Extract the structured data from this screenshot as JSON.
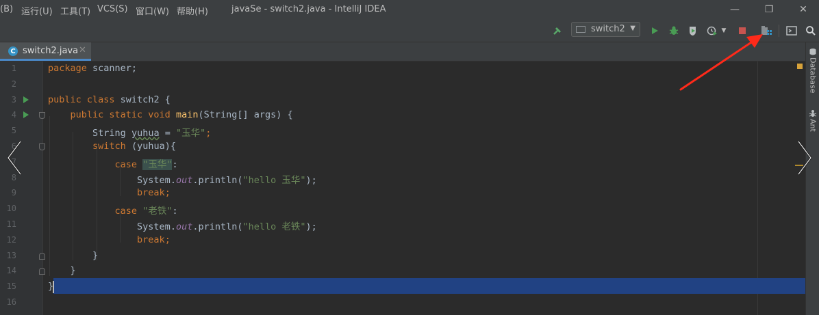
{
  "menubar": {
    "items": [
      "(B)",
      "运行(U)",
      "工具(T)",
      "VCS(S)",
      "窗口(W)",
      "帮助(H)"
    ],
    "title": "javaSe - switch2.java - IntelliJ IDEA",
    "minimize": "—",
    "restore": "❐",
    "close": "✕"
  },
  "toolbar": {
    "run_config": "switch2",
    "icons": [
      "build-hammer-icon",
      "run-icon",
      "debug-icon",
      "coverage-icon",
      "profile-icon",
      "stop-icon",
      "project-structure-icon",
      "terminal-icon",
      "search-icon"
    ]
  },
  "tabs": [
    {
      "label": "switch2.java",
      "close": "✕"
    }
  ],
  "sidebar": {
    "items": [
      "Database",
      "Ant"
    ]
  },
  "editor": {
    "line_numbers": [
      "1",
      "2",
      "3",
      "4",
      "5",
      "6",
      "7",
      "8",
      "9",
      "10",
      "11",
      "12",
      "13",
      "14",
      "15",
      "16"
    ],
    "line1": {
      "kw": "package",
      "rest": " scanner;"
    },
    "line3": {
      "kw": "public class",
      "rest": " switch2 {"
    },
    "line4": {
      "indent": "    ",
      "kw": "public static void",
      "sp": " ",
      "fn": "main",
      "rest": "(String[] args) {"
    },
    "line5": {
      "indent": "        ",
      "pre": "String ",
      "var": "yuhua",
      "eq": " = ",
      "str": "\"玉华\"",
      "end": ";"
    },
    "line6": {
      "indent": "        ",
      "kw": "switch",
      "rest": " (yuhua){"
    },
    "line7": {
      "indent": "            ",
      "kw": "case",
      "sp": " ",
      "str": "\"玉华\"",
      "end": ":"
    },
    "line8": {
      "indent": "                ",
      "pre": "System.",
      "fld": "out",
      "mid": ".println(",
      "str": "\"hello 玉华\"",
      "end": ");"
    },
    "line9": {
      "indent": "                ",
      "kw": "break",
      "end": ";"
    },
    "line10": {
      "indent": "            ",
      "kw": "case",
      "sp": " ",
      "str": "\"老铁\"",
      "end": ":"
    },
    "line11": {
      "indent": "                ",
      "pre": "System.",
      "fld": "out",
      "mid": ".println(",
      "str": "\"hello 老铁\"",
      "end": ");"
    },
    "line12": {
      "indent": "                ",
      "kw": "break",
      "end": ";"
    },
    "line13": {
      "text": "        }"
    },
    "line14": {
      "text": "    }"
    },
    "line15": {
      "text": "}"
    }
  },
  "colors": {
    "background": "#2b2b2b",
    "keyword": "#cc7832",
    "string": "#6a8759",
    "function": "#ffc66d",
    "field": "#9876aa",
    "selection": "#214283",
    "annotation_arrow": "#ff2a1a"
  }
}
